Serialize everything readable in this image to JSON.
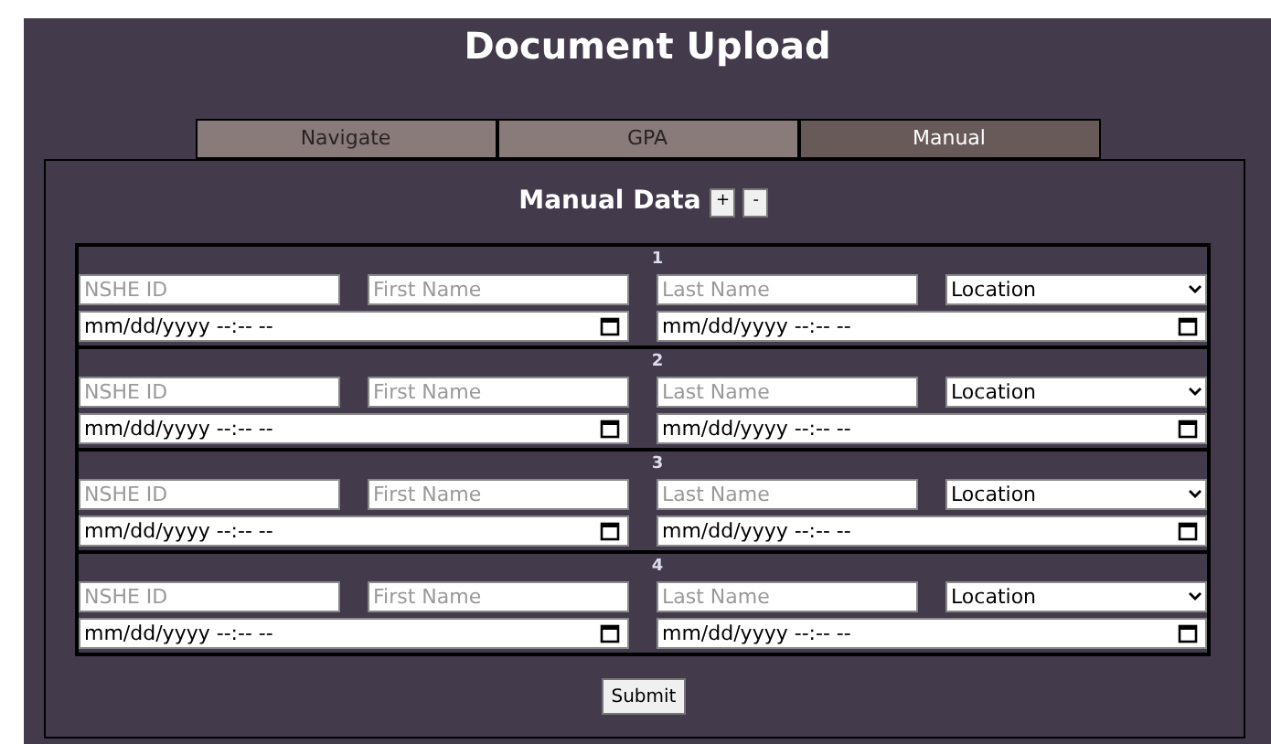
{
  "title": "Document Upload",
  "tabs": [
    {
      "label": "Navigate",
      "selected": false
    },
    {
      "label": "GPA",
      "selected": false
    },
    {
      "label": "Manual",
      "selected": true
    }
  ],
  "section": {
    "title": "Manual Data",
    "add_button": "+",
    "remove_button": "-"
  },
  "entries": [
    {
      "number": "1",
      "id_placeholder": "NSHE ID",
      "first_placeholder": "First Name",
      "last_placeholder": "Last Name",
      "location": "Location",
      "start_date": "mm/dd/yyyy --:-- --",
      "end_date": "mm/dd/yyyy --:-- --"
    },
    {
      "number": "2",
      "id_placeholder": "NSHE ID",
      "first_placeholder": "First Name",
      "last_placeholder": "Last Name",
      "location": "Location",
      "start_date": "mm/dd/yyyy --:-- --",
      "end_date": "mm/dd/yyyy --:-- --"
    },
    {
      "number": "3",
      "id_placeholder": "NSHE ID",
      "first_placeholder": "First Name",
      "last_placeholder": "Last Name",
      "location": "Location",
      "start_date": "mm/dd/yyyy --:-- --",
      "end_date": "mm/dd/yyyy --:-- --"
    },
    {
      "number": "4",
      "id_placeholder": "NSHE ID",
      "first_placeholder": "First Name",
      "last_placeholder": "Last Name",
      "location": "Location",
      "start_date": "mm/dd/yyyy --:-- --",
      "end_date": "mm/dd/yyyy --:-- --"
    }
  ],
  "submit": "Submit"
}
